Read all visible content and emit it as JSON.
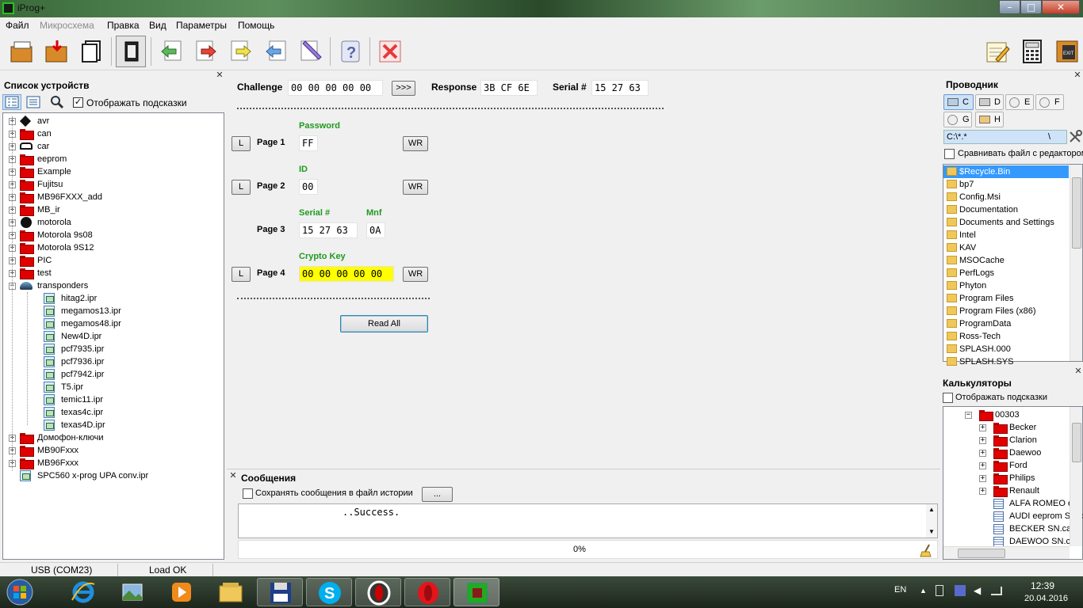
{
  "window": {
    "title": "iProg+",
    "min_label": "–",
    "max_label": "□",
    "close_label": "✕"
  },
  "menu": [
    {
      "label": "Файл",
      "enabled": true
    },
    {
      "label": "Микросхема",
      "enabled": false
    },
    {
      "label": "Правка",
      "enabled": true
    },
    {
      "label": "Вид",
      "enabled": true
    },
    {
      "label": "Параметры",
      "enabled": true
    },
    {
      "label": "Помощь",
      "enabled": true
    }
  ],
  "toolbar": {
    "icons": [
      "open-folder-icon",
      "save-folder-icon",
      "copy-document-icon",
      "chip-icon",
      "read-arrow-icon",
      "write-arrow-icon",
      "verify-arrow-icon",
      "compare-arrow-icon",
      "erase-icon",
      "help-icon",
      "stop-icon"
    ],
    "right_icons": [
      "notepad-icon",
      "calculator-icon",
      "exit-icon"
    ],
    "help_glyph": "?",
    "exit_label": "EXIT"
  },
  "left_panel": {
    "title": "Список устройств",
    "show_hints_label": "Отображать подсказки",
    "show_hints_checked": true,
    "tree": [
      {
        "label": "avr",
        "icon": "chip-icon",
        "expanded": false
      },
      {
        "label": "can",
        "icon": "folder-icon",
        "expanded": false
      },
      {
        "label": "car",
        "icon": "car-icon",
        "expanded": false
      },
      {
        "label": "eeprom",
        "icon": "folder-icon",
        "expanded": false
      },
      {
        "label": "Example",
        "icon": "folder-icon",
        "expanded": false
      },
      {
        "label": "Fujitsu",
        "icon": "folder-icon",
        "expanded": false
      },
      {
        "label": "MB96FXXX_add",
        "icon": "folder-icon",
        "expanded": false
      },
      {
        "label": "MB_ir",
        "icon": "folder-icon",
        "expanded": false
      },
      {
        "label": "motorola",
        "icon": "motorola-icon",
        "expanded": false
      },
      {
        "label": "Motorola 9s08",
        "icon": "folder-icon",
        "expanded": false
      },
      {
        "label": "Motorola 9S12",
        "icon": "folder-icon",
        "expanded": false
      },
      {
        "label": "PIC",
        "icon": "folder-icon",
        "expanded": false
      },
      {
        "label": "test",
        "icon": "folder-icon",
        "expanded": false
      },
      {
        "label": "transponders",
        "icon": "transponder-icon",
        "expanded": true
      },
      {
        "label": "hitag2.ipr",
        "icon": "file-icon",
        "child": true
      },
      {
        "label": "megamos13.ipr",
        "icon": "file-icon",
        "child": true
      },
      {
        "label": "megamos48.ipr",
        "icon": "file-icon",
        "child": true
      },
      {
        "label": "New4D.ipr",
        "icon": "file-icon",
        "child": true
      },
      {
        "label": "pcf7935.ipr",
        "icon": "file-icon",
        "child": true
      },
      {
        "label": "pcf7936.ipr",
        "icon": "file-icon",
        "child": true
      },
      {
        "label": "pcf7942.ipr",
        "icon": "file-icon",
        "child": true
      },
      {
        "label": "T5.ipr",
        "icon": "file-icon",
        "child": true
      },
      {
        "label": "temic11.ipr",
        "icon": "file-icon",
        "child": true
      },
      {
        "label": "texas4c.ipr",
        "icon": "file-icon",
        "child": true
      },
      {
        "label": "texas4D.ipr",
        "icon": "file-icon",
        "child": true
      },
      {
        "label": "Домофон-ключи",
        "icon": "folder-icon",
        "expanded": false
      },
      {
        "label": "MB90Fxxx",
        "icon": "folder-icon",
        "expanded": false
      },
      {
        "label": "MB96Fxxx",
        "icon": "folder-icon",
        "expanded": false
      },
      {
        "label": "SPC560 x-prog UPA conv.ipr",
        "icon": "file-icon",
        "leaf": true
      }
    ]
  },
  "main": {
    "challenge_label": "Challenge",
    "challenge_value": "00 00 00 00 00",
    "send_button": ">>>",
    "response_label": "Response",
    "response_value": "3B CF 6E",
    "serial_label": "Serial #",
    "serial_value": "15 27 63",
    "pages": [
      {
        "l_button": "L",
        "label": "Page 1",
        "field_label": "Password",
        "value": "FF",
        "wr_button": "WR"
      },
      {
        "l_button": "L",
        "label": "Page 2",
        "field_label": "ID",
        "value": "00",
        "wr_button": "WR"
      },
      {
        "label": "Page 3",
        "field_label": "Serial #",
        "value": "15 27 63",
        "field2_label": "Mnf",
        "value2": "0A"
      },
      {
        "l_button": "L",
        "label": "Page 4",
        "field_label": "Crypto Key",
        "value": "00 00 00 00 00",
        "wr_button": "WR",
        "highlight": "#ffff00"
      }
    ],
    "read_all_button": "Read All"
  },
  "messages": {
    "title": "Сообщения",
    "save_history_label": "Сохранять сообщения в файл истории",
    "save_history_checked": false,
    "browse_button": "...",
    "text": "..Success.",
    "progress": "0%"
  },
  "explorer": {
    "title": "Проводник",
    "drives": [
      "C",
      "D",
      "E",
      "F",
      "G",
      "H"
    ],
    "path": "C:\\*.*",
    "path_sep": "\\",
    "compare_label": "Сравнивать файл с редактором",
    "files": [
      "$Recycle.Bin",
      "bp7",
      "Config.Msi",
      "Documentation",
      "Documents and Settings",
      "Intel",
      "KAV",
      "MSOCache",
      "PerfLogs",
      "Phyton",
      "Program Files",
      "Program Files (x86)",
      "ProgramData",
      "Ross-Tech",
      "SPLASH.000",
      "SPLASH.SYS"
    ],
    "selected_file": "$Recycle.Bin"
  },
  "calculators": {
    "title": "Калькуляторы",
    "show_hints_label": "Отображать подсказки",
    "show_hints_checked": false,
    "root": "00303",
    "folders": [
      "Becker",
      "Clarion",
      "Daewoo",
      "Ford",
      "Philips",
      "Renault"
    ],
    "files": [
      "ALFA ROMEO eeprom",
      "AUDI eeprom SN.calc",
      "BECKER SN.calc",
      "DAEWOO SN.calc"
    ]
  },
  "status": {
    "port": "USB (COM23)",
    "load": "Load OK"
  },
  "taskbar": {
    "apps": [
      "windows-start-icon",
      "internet-explorer-icon",
      "photo-viewer-icon",
      "media-player-icon",
      "explorer-folder-icon",
      "floppy-save-icon",
      "skype-icon",
      "opera-icon",
      "opera-red-icon",
      "iprog-icon"
    ],
    "skype_glyph": "S",
    "active_index": 9,
    "lang": "EN",
    "time": "12:39",
    "date": "20.04.2016"
  },
  "colors": {
    "accent_green": "#1f9a1f",
    "highlight_yellow": "#ffff00",
    "folder_red": "#e00000",
    "selection_blue": "#3399ff"
  }
}
